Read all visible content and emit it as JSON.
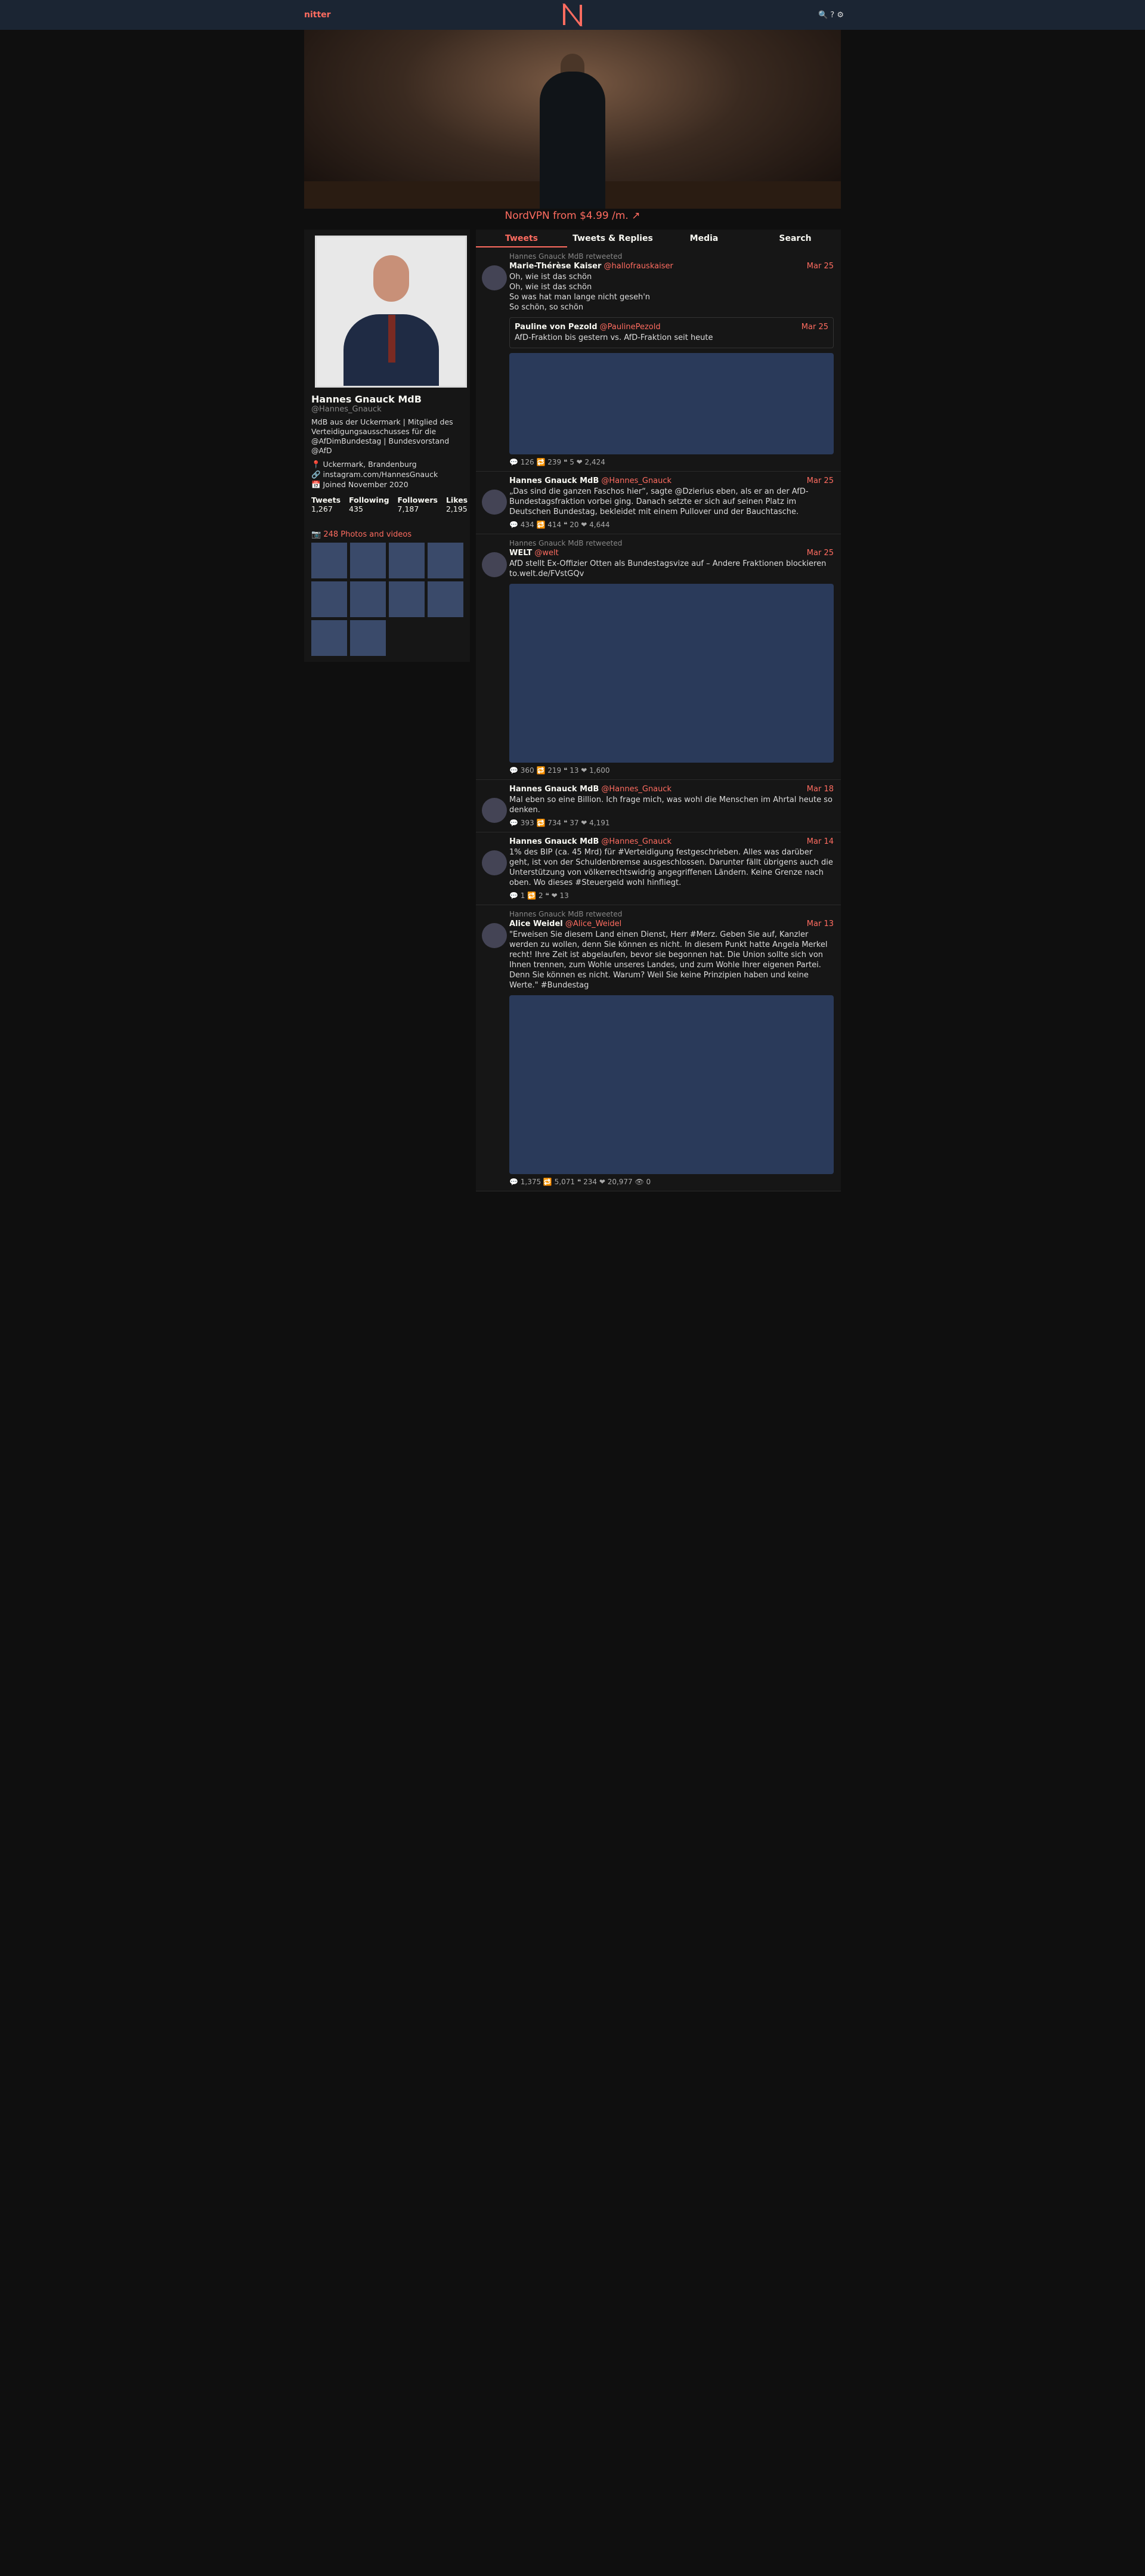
{
  "nav": {
    "brand": "nitter",
    "icons": "🔍 ? ⚙"
  },
  "promo": "NordVPN from $4.99 /m. ↗",
  "profile": {
    "name": "Hannes Gnauck MdB",
    "handle": "@Hannes_Gnauck",
    "bio": "MdB aus der Uckermark | Mitglied des Verteidigungsausschusses für die @AfDimBundestag | Bundesvorstand @AfD",
    "location": "📍 Uckermark, Brandenburg",
    "website": "🔗 instagram.com/HannesGnauck",
    "joined": "📅 Joined November 2020",
    "stats": [
      {
        "label": "Tweets",
        "value": "1,267"
      },
      {
        "label": "Following",
        "value": "435"
      },
      {
        "label": "Followers",
        "value": "7,187"
      },
      {
        "label": "Likes",
        "value": "2,195"
      }
    ],
    "photos_title": "📷 248 Photos and videos"
  },
  "tabs": [
    "Tweets",
    "Tweets & Replies",
    "Media",
    "Search"
  ],
  "tweets": [
    {
      "retweet": "Hannes Gnauck MdB retweeted",
      "name": "Marie-Thérèse Kaiser",
      "handle": "@hallofrauskaiser",
      "date": "Mar 25",
      "text": "Oh, wie ist das schön\nOh, wie ist das schön\nSo was hat man lange nicht geseh'n\nSo schön, so schön",
      "stats": "💬 126  🔁 239  ❝ 5  ❤ 2,424",
      "quote": {
        "name": "Pauline von Pezold",
        "handle": "@PaulinePezold",
        "date": "Mar 25",
        "text": "AfD-Fraktion bis gestern vs. AfD-Fraktion seit heute"
      },
      "media_h": 170
    },
    {
      "retweet": "",
      "name": "Hannes Gnauck MdB",
      "handle": "@Hannes_Gnauck",
      "date": "Mar 25",
      "text": "„Das sind die ganzen Faschos hier“, sagte @Dzierius eben, als er an der AfD-Bundestagsfraktion vorbei ging. Danach setzte er sich auf seinen Platz im Deutschen Bundestag, bekleidet mit einem Pullover und der Bauchtasche.",
      "stats": "💬 434  🔁 414  ❝ 20  ❤ 4,644",
      "media_h": 0
    },
    {
      "retweet": "Hannes Gnauck MdB retweeted",
      "name": "WELT",
      "handle": "@welt",
      "date": "Mar 25",
      "text": "AfD stellt Ex-Offizier Otten als Bundestagsvize auf – Andere Fraktionen blockieren\nto.welt.de/FVstGQv",
      "stats": "💬 360  🔁 219  ❝ 13  ❤ 1,600",
      "media_h": 300
    },
    {
      "retweet": "",
      "name": "Hannes Gnauck MdB",
      "handle": "@Hannes_Gnauck",
      "date": "Mar 18",
      "text": "Mal eben so eine Billion. Ich frage mich, was wohl die Menschen im Ahrtal heute so denken.",
      "stats": "💬 393  🔁 734  ❝ 37  ❤ 4,191",
      "media_h": 0
    },
    {
      "retweet": "",
      "name": "Hannes Gnauck MdB",
      "handle": "@Hannes_Gnauck",
      "date": "Mar 14",
      "text": "1% des BIP (ca. 45 Mrd) für #Verteidigung festgeschrieben. Alles was darüber geht, ist von der Schuldenbremse ausgeschlossen. Darunter fällt übrigens auch die Unterstützung von völkerrechtswidrig angegriffenen Ländern. Keine Grenze nach oben. Wo dieses #Steuergeld wohl hinfliegt.",
      "stats": "💬 1  🔁 2  ❝  ❤ 13",
      "media_h": 0
    },
    {
      "retweet": "Hannes Gnauck MdB retweeted",
      "name": "Alice Weidel",
      "handle": "@Alice_Weidel",
      "date": "Mar 13",
      "text": "\"Erweisen Sie diesem Land einen Dienst, Herr #Merz. Geben Sie auf, Kanzler werden zu wollen, denn Sie können es nicht. In diesem Punkt hatte Angela Merkel recht! Ihre Zeit ist abgelaufen, bevor sie begonnen hat. Die Union sollte sich von Ihnen trennen, zum Wohle unseres Landes, und zum Wohle Ihrer eigenen Partei. Denn Sie können es nicht. Warum? Weil Sie keine Prinzipien haben und keine Werte.\" #Bundestag",
      "stats": "💬 1,375  🔁 5,071  ❝ 234  ❤ 20,977  👁 0",
      "media_h": 300
    }
  ]
}
